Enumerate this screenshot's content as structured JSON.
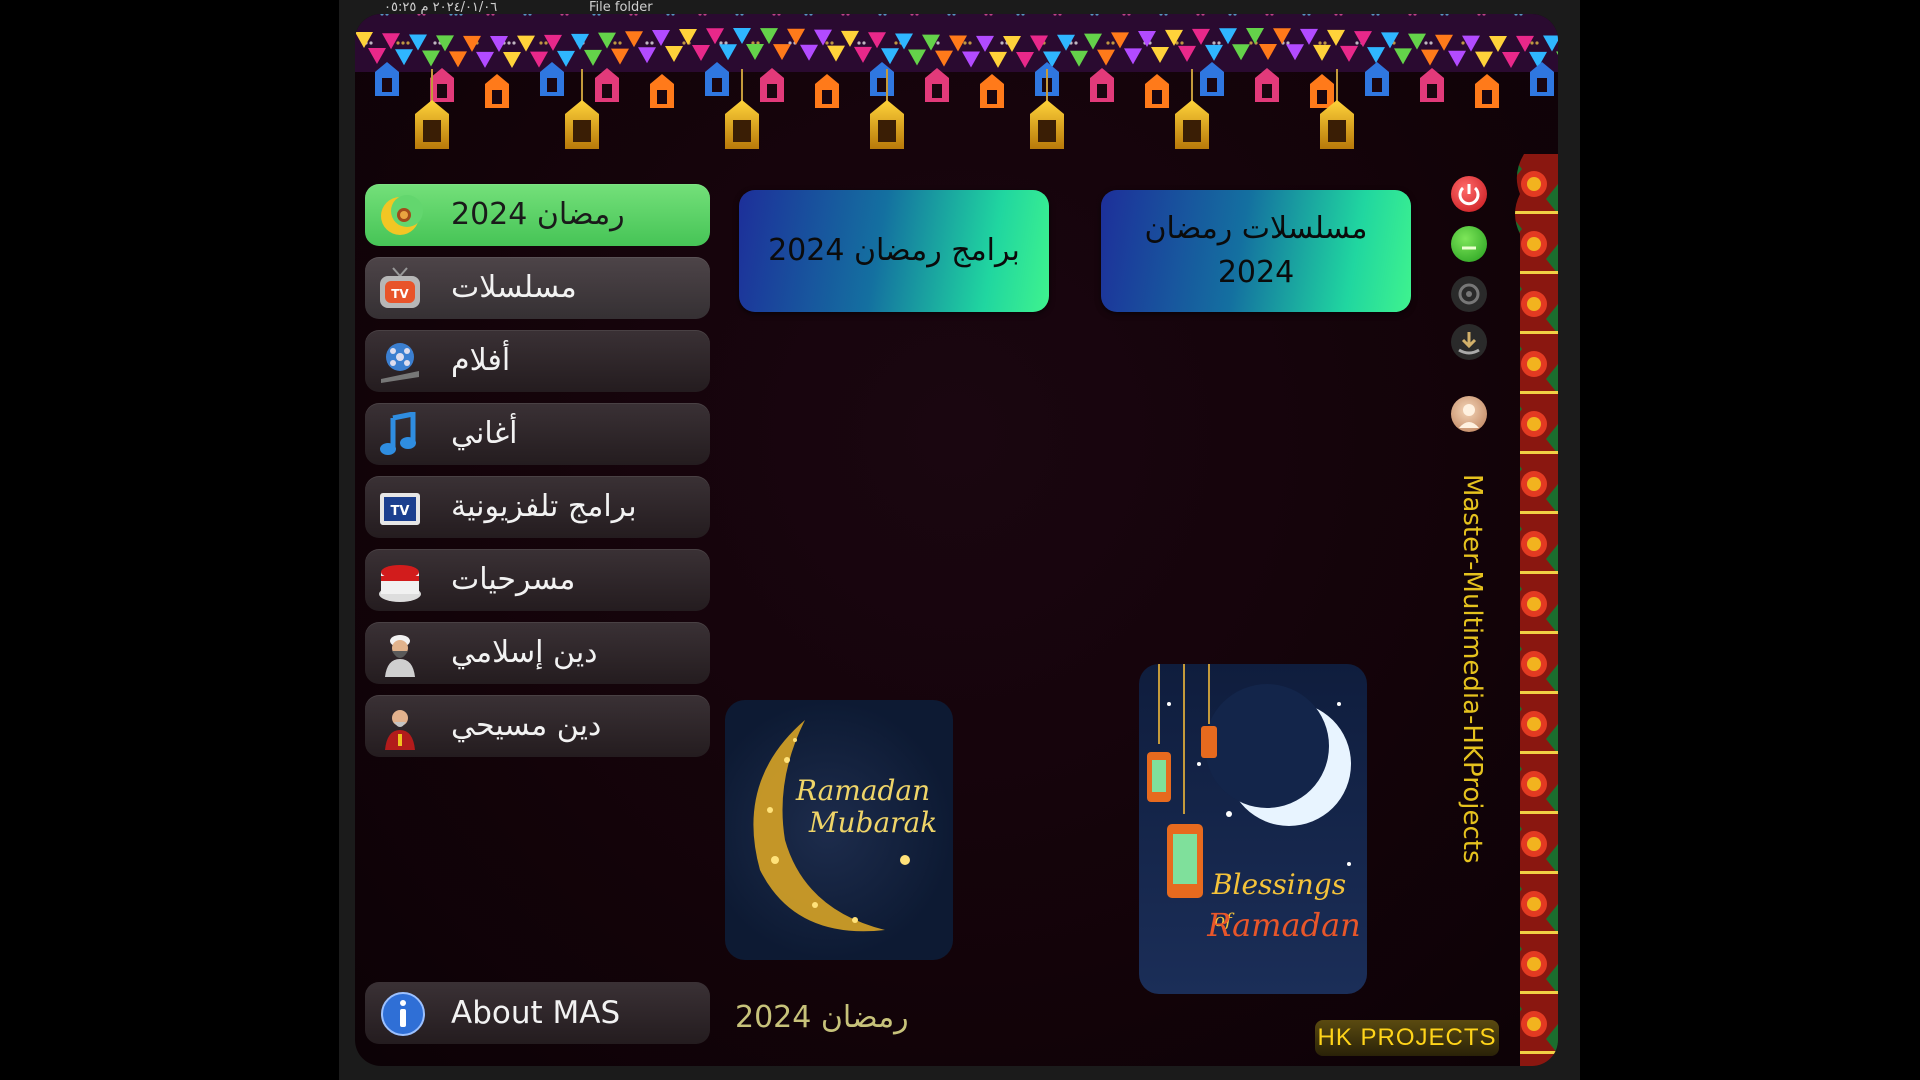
{
  "topbar": {
    "date": "٢٠٢٤/٠١/٠٦ م ٠٥:٢٥",
    "type": "File folder"
  },
  "menu": {
    "items": [
      {
        "label": "رمضان 2024",
        "icon": "ramadan-moon-icon",
        "state": "active"
      },
      {
        "label": "مسلسلات",
        "icon": "tv-icon",
        "state": "hover"
      },
      {
        "label": "أفلام",
        "icon": "film-reel-icon",
        "state": "normal"
      },
      {
        "label": "أغاني",
        "icon": "music-note-icon",
        "state": "normal"
      },
      {
        "label": "برامج تلفزيونية",
        "icon": "tv-program-icon",
        "state": "normal"
      },
      {
        "label": "مسرحيات",
        "icon": "theater-icon",
        "state": "normal"
      },
      {
        "label": "دين إسلامي",
        "icon": "sheikh-icon",
        "state": "normal"
      },
      {
        "label": "دين مسيحي",
        "icon": "priest-icon",
        "state": "normal"
      }
    ],
    "about": "About MAS"
  },
  "tiles": {
    "programs": "برامج رمضان 2024",
    "series_line1": "مسلسلات رمضان",
    "series_line2": "2024"
  },
  "cards": {
    "left_line1": "Ramadan",
    "left_line2": "Mubarak",
    "right_line1": "Blessings",
    "right_line2": "of",
    "right_line3": "Ramadan"
  },
  "footer": {
    "section_label": "رمضان 2024",
    "brand": "HK PROJECTS"
  },
  "side_title": "Master-Multimedia-HKProjects",
  "colors": {
    "active": "#5cd26a",
    "tile_start": "#1d2f9a",
    "tile_end": "#3ff38e",
    "accent_gold": "#ffd41a",
    "close_red": "#e8222b",
    "min_green": "#3fc93a"
  }
}
